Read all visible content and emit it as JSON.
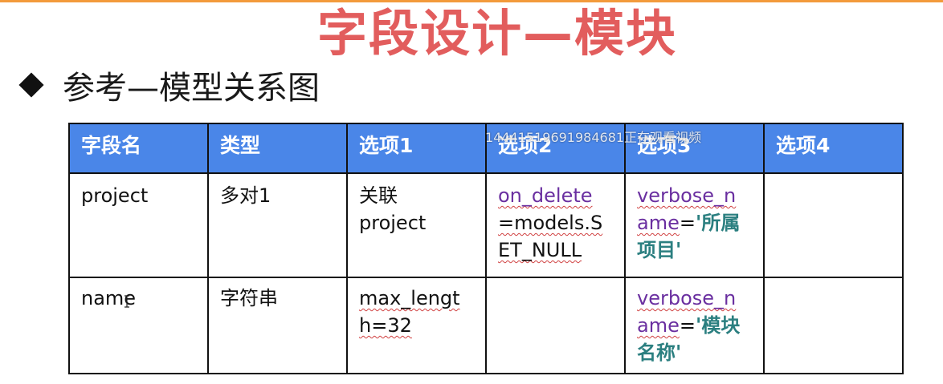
{
  "slide": {
    "title": "字段设计—模块",
    "bullet": "参考—模型关系图",
    "watermark": "14441519691984681正在观看视频"
  },
  "table": {
    "headers": [
      "字段名",
      "类型",
      "选项1",
      "选项2",
      "选项3",
      "选项4"
    ],
    "rows": [
      {
        "field": "project",
        "type": "多对1",
        "opt1_line1": "关联",
        "opt1_line2": "project",
        "opt2_a": "on_delete",
        "opt2_b": "=models.S",
        "opt2_c": "ET_NULL",
        "opt3_a": "verbose_n",
        "opt3_b": "ame",
        "opt3_eq": "=",
        "opt3_c": "'所属",
        "opt3_d": "项目'",
        "opt4": ""
      },
      {
        "field": "name",
        "type": "字符串",
        "opt1_a": "max_lengt",
        "opt1_b": "h=32",
        "opt2": "",
        "opt3_a": "verbose_n",
        "opt3_b": "ame",
        "opt3_eq": "=",
        "opt3_c": "'模块",
        "opt3_d": "名称'",
        "opt4": ""
      }
    ]
  },
  "colors": {
    "title": "#e25d5d",
    "header_bg": "#4a86e8",
    "accent_bar": "#f39a3b",
    "purple_text": "#6a2fa0",
    "teal_text": "#2b7f80"
  }
}
